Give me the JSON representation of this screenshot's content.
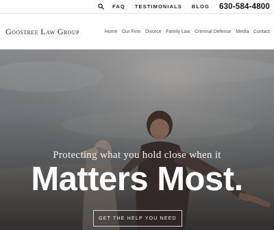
{
  "utility": {
    "links": [
      "FAQ",
      "TESTIMONIALS",
      "BLOG"
    ],
    "phone": "630-584-4800"
  },
  "nav": {
    "logo": "Goostree Law Group",
    "items": [
      "Home",
      "Our Firm",
      "Divorce",
      "Family Law",
      "Criminal Defense",
      "Media",
      "Contact"
    ]
  },
  "hero": {
    "tagline": "Protecting what you hold close when it",
    "headline": "Matters Most.",
    "cta_label": "GET THE HELP YOU NEED"
  },
  "icons": {
    "search": "search-icon"
  }
}
